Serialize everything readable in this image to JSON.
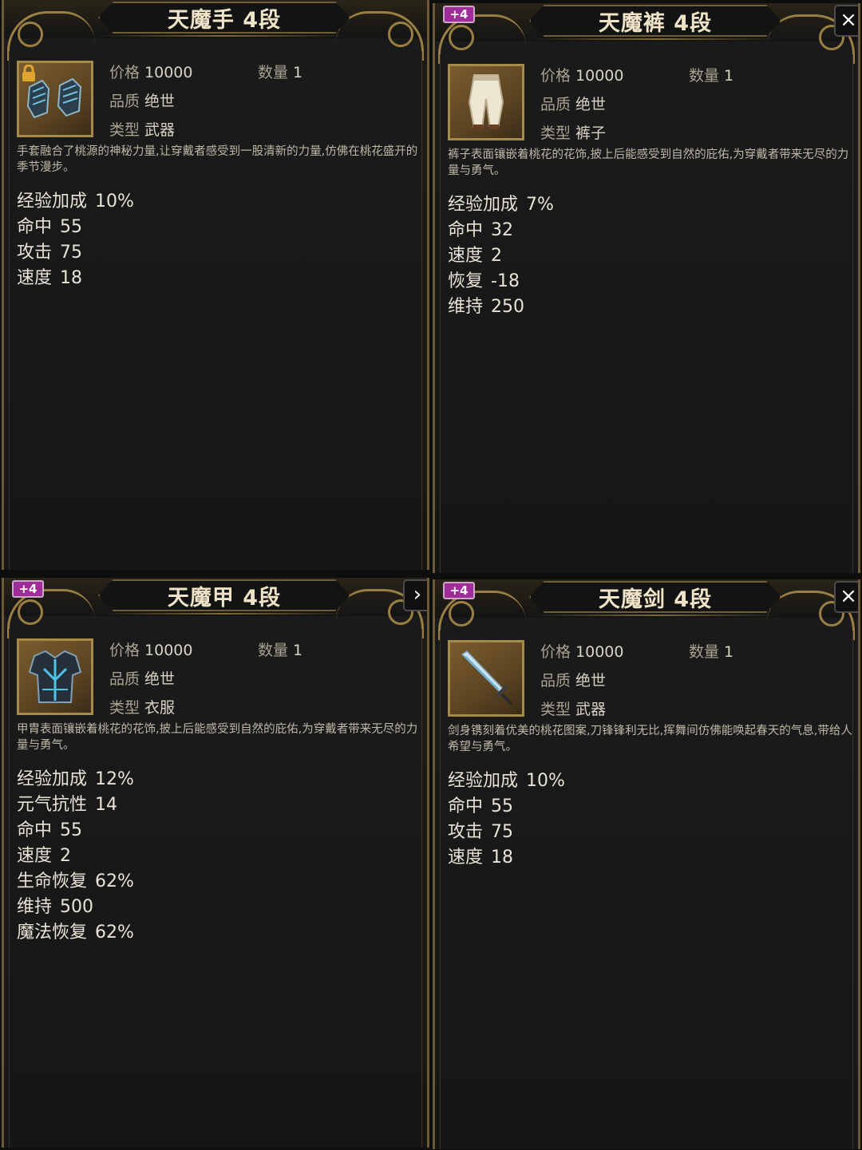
{
  "labels": {
    "price": "价格",
    "quantity": "数量",
    "quality": "品质",
    "type": "类型"
  },
  "colors": {
    "panel_bg": "#181818",
    "gold_frame": "#9a7f45",
    "badge_magenta": "#a02c9a",
    "text_primary": "#e8e3d6"
  },
  "panels": [
    {
      "title": "天魔手 4段",
      "badge": "",
      "icon": "gauntlets-icon",
      "locked": true,
      "price": "10000",
      "quantity": "1",
      "quality": "绝世",
      "type": "武器",
      "description": "手套融合了桃源的神秘力量,让穿戴者感受到一股清新的力量,仿佛在桃花盛开的季节漫步。",
      "stats": [
        {
          "name": "经验加成",
          "value": "10%"
        },
        {
          "name": "命中",
          "value": "55"
        },
        {
          "name": "攻击",
          "value": "75"
        },
        {
          "name": "速度",
          "value": "18"
        }
      ]
    },
    {
      "title": "天魔裤 4段",
      "badge": "+4",
      "icon": "pants-icon",
      "locked": false,
      "price": "10000",
      "quantity": "1",
      "quality": "绝世",
      "type": "裤子",
      "description": "裤子表面镶嵌着桃花的花饰,披上后能感受到自然的庇佑,为穿戴者带来无尽的力量与勇气。",
      "stats": [
        {
          "name": "经验加成",
          "value": "7%"
        },
        {
          "name": "命中",
          "value": "32"
        },
        {
          "name": "速度",
          "value": "2"
        },
        {
          "name": "恢复",
          "value": "-18"
        },
        {
          "name": "维持",
          "value": "250"
        }
      ]
    },
    {
      "title": "天魔甲 4段",
      "badge": "+4",
      "icon": "armor-icon",
      "locked": false,
      "price": "10000",
      "quantity": "1",
      "quality": "绝世",
      "type": "衣服",
      "description": "甲胄表面镶嵌着桃花的花饰,披上后能感受到自然的庇佑,为穿戴者带来无尽的力量与勇气。",
      "stats": [
        {
          "name": "经验加成",
          "value": "12%"
        },
        {
          "name": "元气抗性",
          "value": "14"
        },
        {
          "name": "命中",
          "value": "55"
        },
        {
          "name": "速度",
          "value": "2"
        },
        {
          "name": "生命恢复",
          "value": "62%"
        },
        {
          "name": "维持",
          "value": "500"
        },
        {
          "name": "魔法恢复",
          "value": "62%"
        }
      ]
    },
    {
      "title": "天魔剑 4段",
      "badge": "+4",
      "icon": "sword-icon",
      "locked": false,
      "price": "10000",
      "quantity": "1",
      "quality": "绝世",
      "type": "武器",
      "description": "剑身镌刻着优美的桃花图案,刀锋锋利无比,挥舞间仿佛能唤起春天的气息,带给人希望与勇气。",
      "stats": [
        {
          "name": "经验加成",
          "value": "10%"
        },
        {
          "name": "命中",
          "value": "55"
        },
        {
          "name": "攻击",
          "value": "75"
        },
        {
          "name": "速度",
          "value": "18"
        }
      ]
    }
  ]
}
